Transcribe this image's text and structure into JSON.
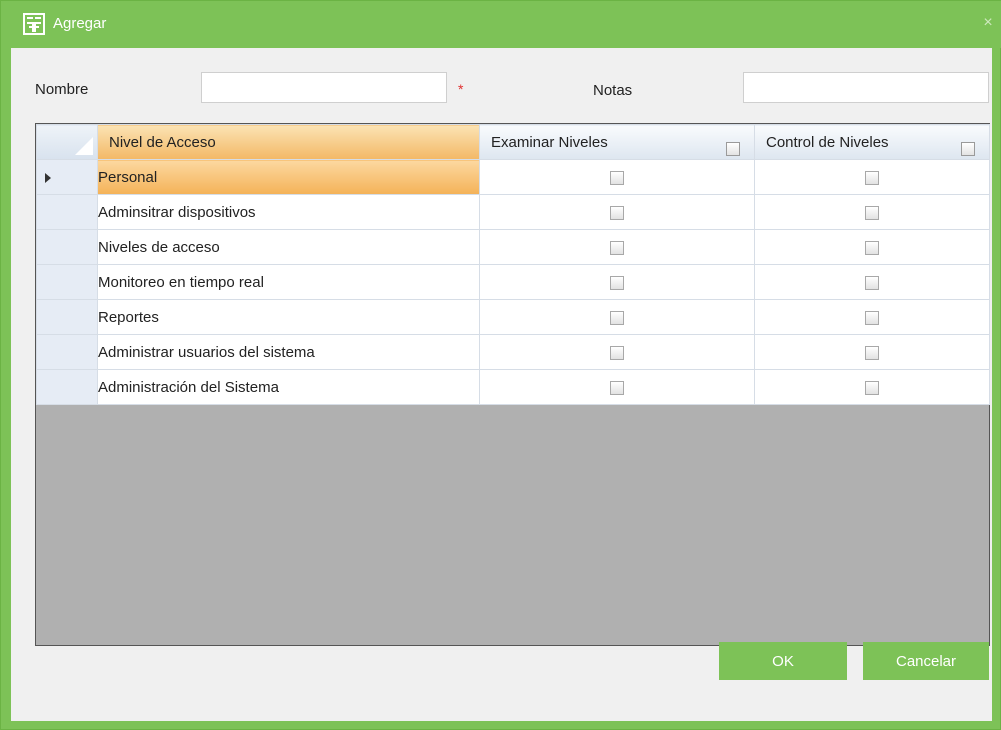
{
  "dialog": {
    "title": "Agregar",
    "close_glyph": "×",
    "icon": "edit-form-icon"
  },
  "form": {
    "name_label": "Nombre",
    "name_value": "",
    "required_mark": "*",
    "notes_label": "Notas",
    "notes_value": ""
  },
  "grid": {
    "columns": [
      "Nivel de Acceso",
      "Examinar Niveles",
      "Control de Niveles"
    ],
    "rows": [
      {
        "label": "Personal",
        "examinar": false,
        "control": false,
        "selected": true
      },
      {
        "label": "Adminsitrar dispositivos",
        "examinar": false,
        "control": false
      },
      {
        "label": "Niveles de acceso",
        "examinar": false,
        "control": false
      },
      {
        "label": "Monitoreo en tiempo real",
        "examinar": false,
        "control": false
      },
      {
        "label": "Reportes",
        "examinar": false,
        "control": false
      },
      {
        "label": "Administrar usuarios del sistema",
        "examinar": false,
        "control": false
      },
      {
        "label": "Administración del Sistema",
        "examinar": false,
        "control": false
      }
    ]
  },
  "buttons": {
    "ok": "OK",
    "cancel": "Cancelar"
  },
  "colors": {
    "accent": "#7dc257",
    "selection": "#f4b258",
    "required": "#e03030"
  }
}
